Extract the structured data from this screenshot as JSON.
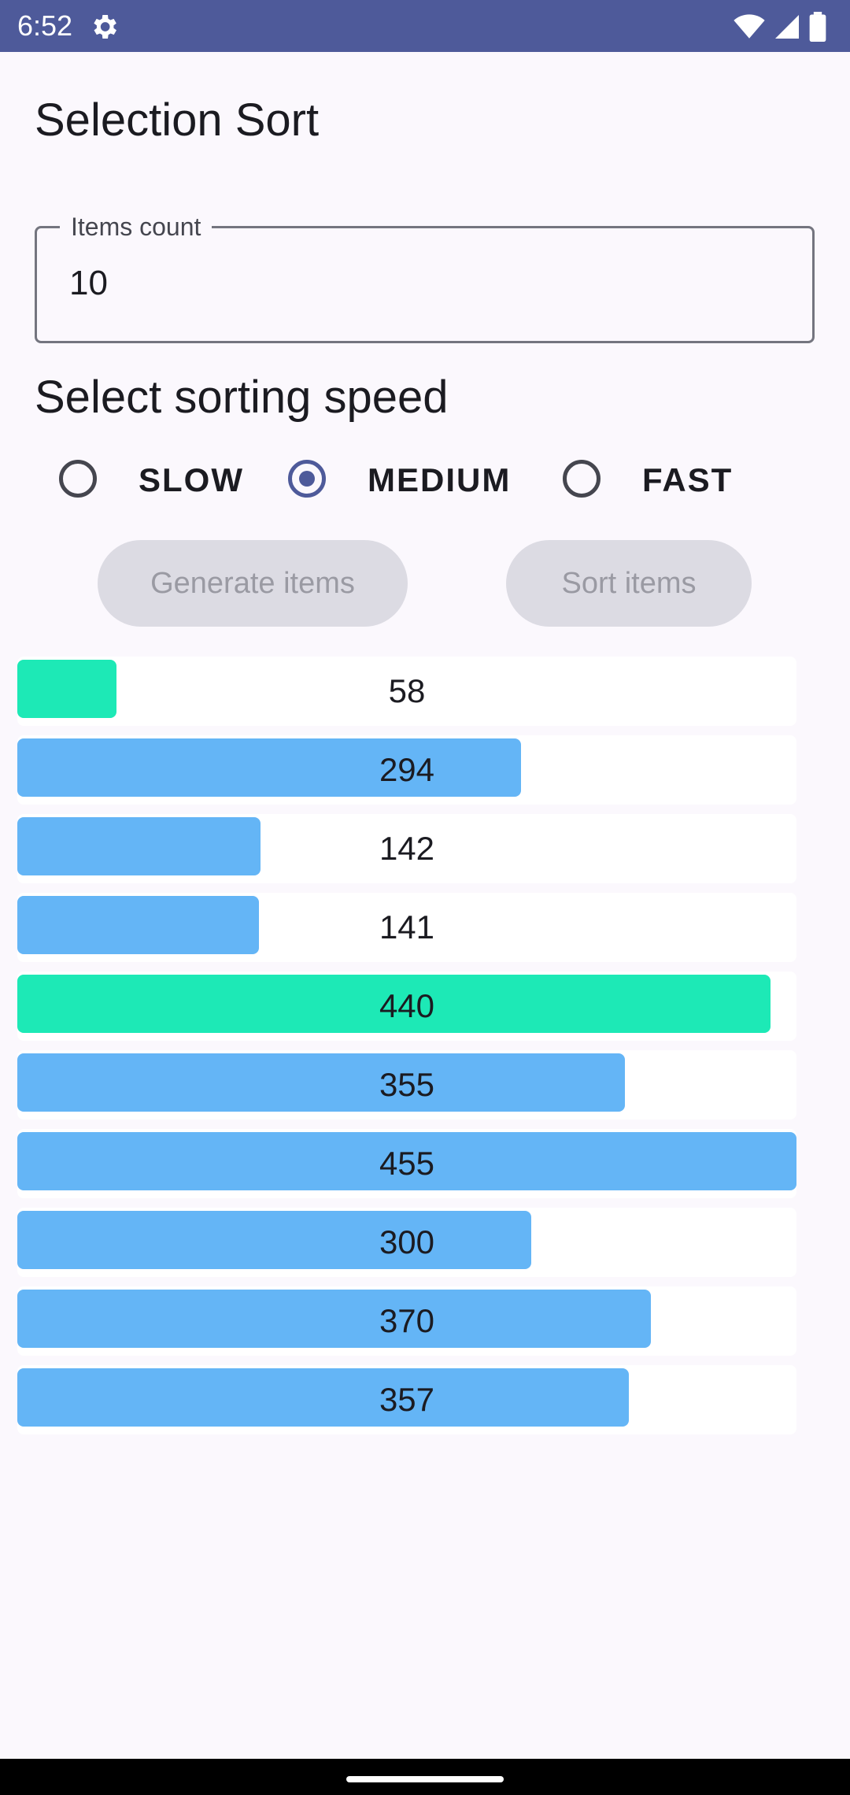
{
  "status_bar": {
    "time": "6:52",
    "icons": [
      "settings-gear-icon",
      "wifi-icon",
      "signal-icon",
      "battery-icon"
    ]
  },
  "screen": {
    "title": "Selection Sort"
  },
  "items_count_field": {
    "label": "Items count",
    "value": "10"
  },
  "speed_section": {
    "title": "Select sorting speed",
    "options": [
      {
        "label": "SLOW",
        "selected": false
      },
      {
        "label": "MEDIUM",
        "selected": true
      },
      {
        "label": "FAST",
        "selected": false
      }
    ]
  },
  "actions": {
    "generate_label": "Generate items",
    "sort_label": "Sort items"
  },
  "colors": {
    "primary": "#4e5a9a",
    "bar_default": "#64b5f6",
    "bar_highlight": "#1de9b6",
    "background": "#fbf8fd"
  },
  "chart_data": {
    "type": "bar",
    "orientation": "horizontal",
    "max_value": 455,
    "values": [
      58,
      294,
      142,
      141,
      440,
      355,
      455,
      300,
      370,
      357
    ],
    "labels": [
      "58",
      "294",
      "142",
      "141",
      "440",
      "355",
      "455",
      "300",
      "370",
      "357"
    ],
    "highlighted": [
      true,
      false,
      false,
      false,
      true,
      false,
      false,
      false,
      false,
      false
    ]
  }
}
